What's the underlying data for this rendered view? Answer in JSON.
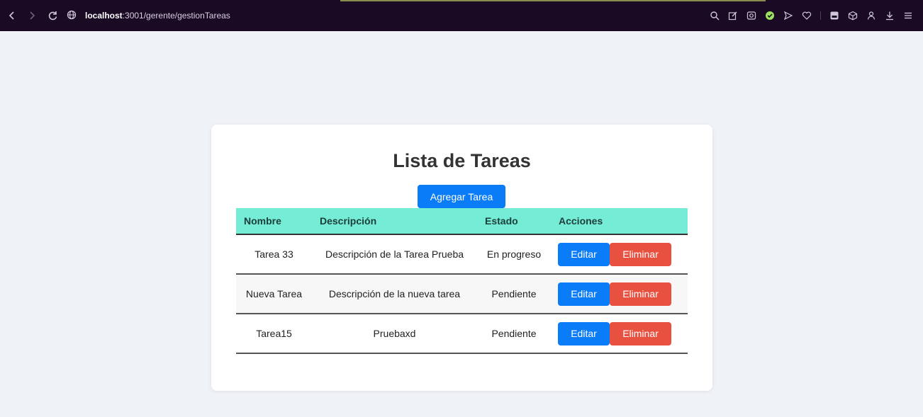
{
  "browser": {
    "url_host": "localhost",
    "url_path": ":3001/gerente/gestionTareas",
    "icons": [
      "back-icon",
      "forward-icon",
      "reload-icon",
      "globe-icon",
      "search-icon",
      "edit-icon",
      "camera-icon",
      "shield-icon",
      "send-icon",
      "heart-icon",
      "bookmark-icon",
      "cube-icon",
      "user-icon",
      "download-icon",
      "menu-icon"
    ]
  },
  "page": {
    "title": "Lista de Tareas",
    "add_label": "Agregar Tarea"
  },
  "table": {
    "headers": [
      "Nombre",
      "Descripción",
      "Estado",
      "Acciones"
    ],
    "rows": [
      {
        "nombre": "Tarea 33",
        "descripcion": "Descripción de la Tarea Prueba",
        "estado": "En progreso"
      },
      {
        "nombre": "Nueva Tarea",
        "descripcion": "Descripción de la nueva tarea",
        "estado": "Pendiente"
      },
      {
        "nombre": "Tarea15",
        "descripcion": "Pruebaxd",
        "estado": "Pendiente"
      }
    ],
    "edit_label": "Editar",
    "delete_label": "Eliminar"
  },
  "colors": {
    "primary": "#0a7cf7",
    "danger": "#e8503f",
    "header_bg": "#74ecd6",
    "toolbar": "#1a0a24"
  }
}
